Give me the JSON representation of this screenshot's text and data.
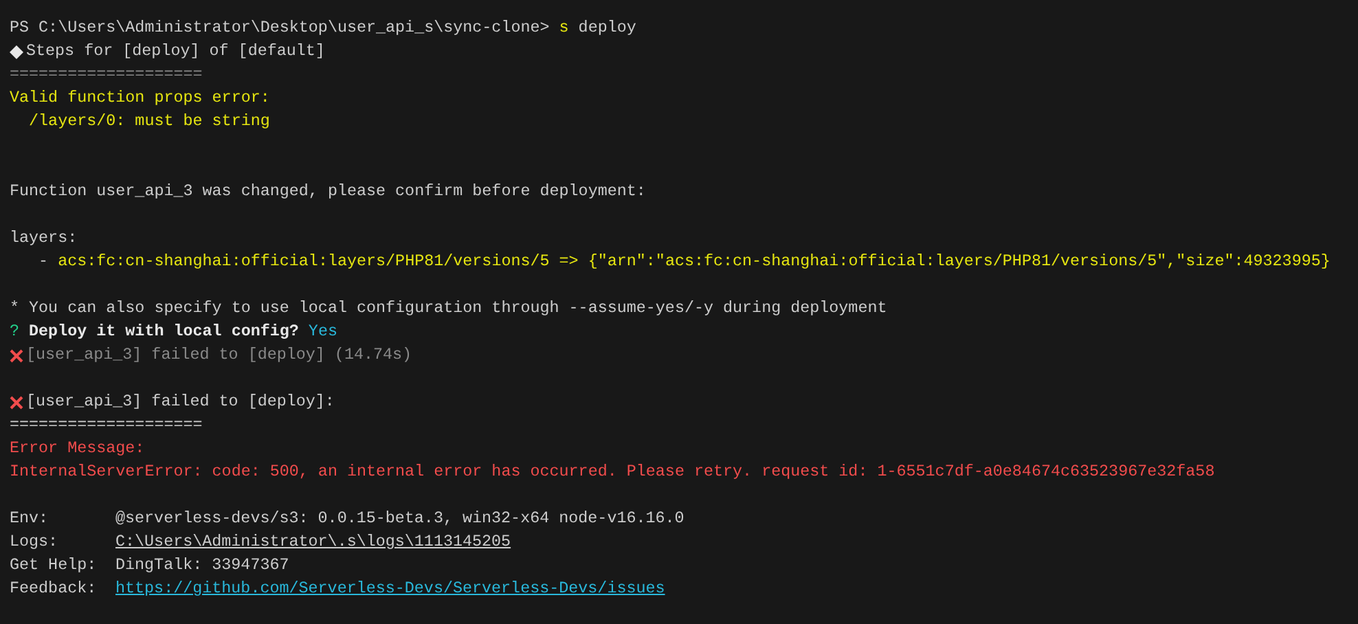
{
  "terminal": {
    "lines": [
      {
        "kind": "text",
        "segments": [
          {
            "text": "PS C:\\Users\\Administrator\\Desktop\\user_api_s\\sync-clone> ",
            "kind": "plain"
          },
          {
            "text": "s",
            "kind": "command"
          },
          {
            "text": " deploy",
            "kind": "plain"
          }
        ]
      },
      {
        "kind": "step",
        "segments": [
          {
            "text": "Steps for [deploy] of [default]",
            "kind": "plain"
          }
        ]
      },
      {
        "kind": "text",
        "segments": [
          {
            "text": "====================",
            "kind": "dim"
          }
        ]
      },
      {
        "kind": "text",
        "segments": [
          {
            "text": "Valid function props error:",
            "kind": "warning"
          }
        ]
      },
      {
        "kind": "text",
        "segments": [
          {
            "text": "  /layers/0: must be string",
            "kind": "warning"
          }
        ]
      },
      {
        "kind": "blank"
      },
      {
        "kind": "blank"
      },
      {
        "kind": "text",
        "segments": [
          {
            "text": "Function user_api_3 was changed, please confirm before deployment:",
            "kind": "plain"
          }
        ]
      },
      {
        "kind": "blank"
      },
      {
        "kind": "text",
        "segments": [
          {
            "text": "layers:",
            "kind": "plain"
          }
        ]
      },
      {
        "kind": "text",
        "segments": [
          {
            "text": "   - ",
            "kind": "plain"
          },
          {
            "text": "acs:fc:cn-shanghai:official:layers/PHP81/versions/5 => {\"arn\":\"acs:fc:cn-shanghai:official:layers/PHP81/versions/5\",\"size\":49323995}",
            "kind": "warning"
          }
        ]
      },
      {
        "kind": "blank"
      },
      {
        "kind": "text",
        "segments": [
          {
            "text": "* You can also specify to use local configuration through --assume-yes/-y during deployment",
            "kind": "plain"
          }
        ]
      },
      {
        "kind": "text",
        "segments": [
          {
            "text": "?",
            "kind": "question"
          },
          {
            "text": " Deploy it with local config?",
            "kind": "bold"
          },
          {
            "text": " Yes",
            "kind": "answer"
          }
        ]
      },
      {
        "kind": "failure",
        "segments": [
          {
            "text": "[user_api_3] failed to [deploy] (14.74s)",
            "kind": "dim"
          }
        ]
      },
      {
        "kind": "blank"
      },
      {
        "kind": "failure",
        "segments": [
          {
            "text": "[user_api_3] failed to [deploy]:",
            "kind": "plain"
          }
        ]
      },
      {
        "kind": "text",
        "segments": [
          {
            "text": "====================",
            "kind": "plain"
          }
        ]
      },
      {
        "kind": "text",
        "segments": [
          {
            "text": "Error Message:",
            "kind": "error"
          }
        ]
      },
      {
        "kind": "text",
        "segments": [
          {
            "text": "InternalServerError: code: 500, an internal error has occurred. Please retry. request id: 1-6551c7df-a0e84674c63523967e32fa58",
            "kind": "error"
          }
        ]
      },
      {
        "kind": "blank"
      },
      {
        "kind": "field",
        "label": "Env:",
        "segments": [
          {
            "text": "@serverless-devs/s3: 0.0.15-beta.3, win32-x64 node-v16.16.0",
            "kind": "plain"
          }
        ]
      },
      {
        "kind": "field",
        "label": "Logs:",
        "segments": [
          {
            "text": "C:\\Users\\Administrator\\.s\\logs\\1113145205",
            "kind": "path"
          }
        ]
      },
      {
        "kind": "field",
        "label": "Get Help:",
        "segments": [
          {
            "text": "DingTalk: 33947367",
            "kind": "plain"
          }
        ]
      },
      {
        "kind": "field",
        "label": "Feedback:",
        "segments": [
          {
            "text": "https://github.com/Serverless-Devs/Serverless-Devs/issues",
            "kind": "link"
          }
        ]
      }
    ]
  }
}
